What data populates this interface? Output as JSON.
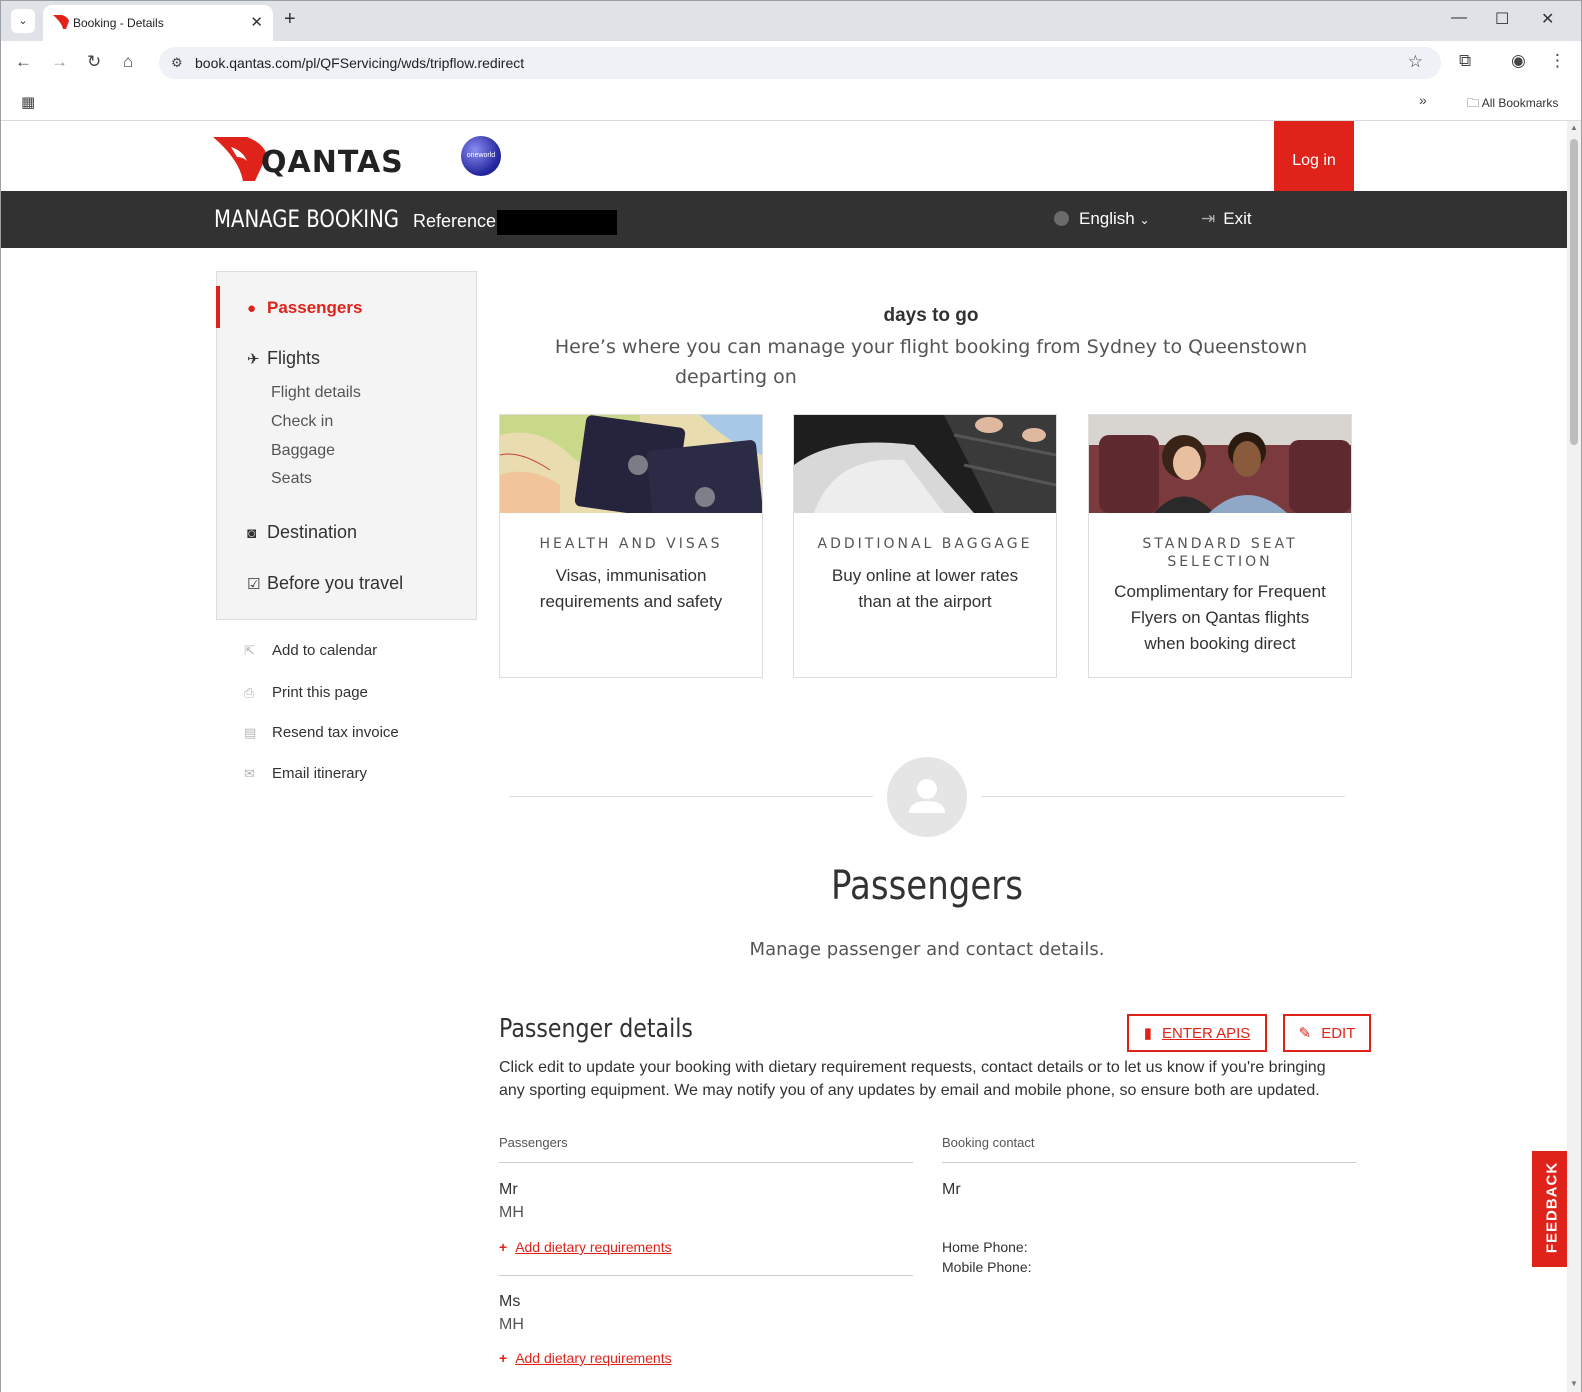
{
  "browser": {
    "tab_title": "Booking - Details",
    "url": "book.qantas.com/pl/QFServicing/wds/tripflow.redirect",
    "all_bookmarks": "All Bookmarks"
  },
  "header": {
    "brand": "QANTAS",
    "alliance": "oneworld",
    "login": "Log in"
  },
  "navband": {
    "title": "MANAGE BOOKING",
    "reference_label": "Reference",
    "language": "English",
    "exit": "Exit"
  },
  "sidebar": {
    "passengers": "Passengers",
    "flights": "Flights",
    "flight_subitems": [
      "Flight details",
      "Check in",
      "Baggage",
      "Seats"
    ],
    "destination": "Destination",
    "before_you_travel": "Before you travel"
  },
  "utilities": [
    "Add to calendar",
    "Print this page",
    "Resend tax invoice",
    "Email itinerary"
  ],
  "main": {
    "days_to_go": "days to go",
    "intro_line1": "Here’s where you can manage your flight booking from Sydney to Queenstown",
    "intro_line2": "departing on"
  },
  "cards": [
    {
      "kicker": "HEALTH AND VISAS",
      "desc": "Visas, immunisation requirements and safety"
    },
    {
      "kicker": "ADDITIONAL BAGGAGE",
      "desc": "Buy online at lower rates than at the airport"
    },
    {
      "kicker": "STANDARD SEAT SELECTION",
      "desc": "Complimentary for Frequent Flyers on Qantas flights when booking direct"
    }
  ],
  "passengers_section": {
    "title": "Passengers",
    "subtitle": "Manage passenger and contact details."
  },
  "passenger_details": {
    "title": "Passenger details",
    "enter_apis": "ENTER APIS",
    "edit": "EDIT",
    "description": "Click edit to update your booking with dietary requirement requests, contact details or to let us know if you're bringing any sporting equipment. We may notify you of any updates by email and mobile phone, so ensure both are updated.",
    "passengers_label": "Passengers",
    "booking_contact_label": "Booking contact",
    "passengers": [
      {
        "title": "Mr",
        "initials": "MH",
        "dietary": "Add dietary requirements"
      },
      {
        "title": "Ms",
        "initials": "MH",
        "dietary": "Add dietary requirements"
      }
    ],
    "contact": {
      "title": "Mr",
      "home_phone": "Home Phone:",
      "mobile_phone": "Mobile Phone:"
    }
  },
  "feedback": "FEEDBACK",
  "colors": {
    "brand_red": "#e0231a",
    "nav_dark": "#323232"
  }
}
